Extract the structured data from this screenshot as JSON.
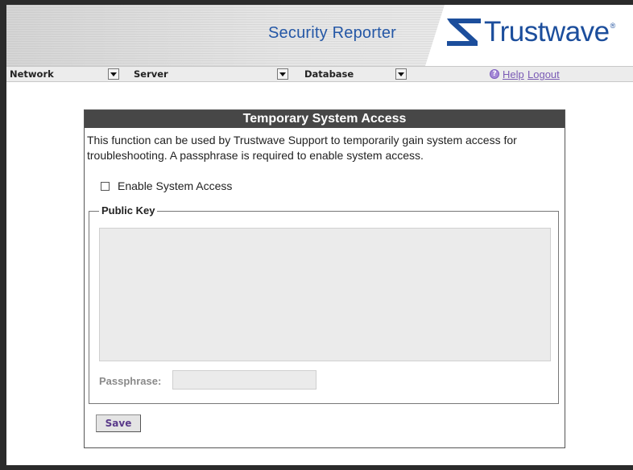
{
  "header": {
    "app_title": "Security Reporter",
    "logo_text": "Trustwave",
    "logo_registered": "®",
    "brand_color": "#1c4e9c"
  },
  "nav": {
    "items": [
      {
        "label": "Network"
      },
      {
        "label": "Server"
      },
      {
        "label": "Database"
      }
    ],
    "help_icon_glyph": "?",
    "help_label": "Help",
    "logout_label": "Logout",
    "link_color": "#7a5bb5"
  },
  "panel": {
    "title": "Temporary System Access",
    "description": "This function can be used by Trustwave Support to temporarily gain system access for troubleshooting. A passphrase is required to enable system access.",
    "enable_checkbox_label": "Enable System Access",
    "enable_checked": false,
    "public_key_legend": "Public Key",
    "public_key_value": "",
    "passphrase_label": "Passphrase:",
    "passphrase_value": "",
    "save_label": "Save"
  },
  "icons": [
    "trustwave-logo-icon",
    "chevron-down-icon",
    "help-icon",
    "resize-grip-icon"
  ]
}
